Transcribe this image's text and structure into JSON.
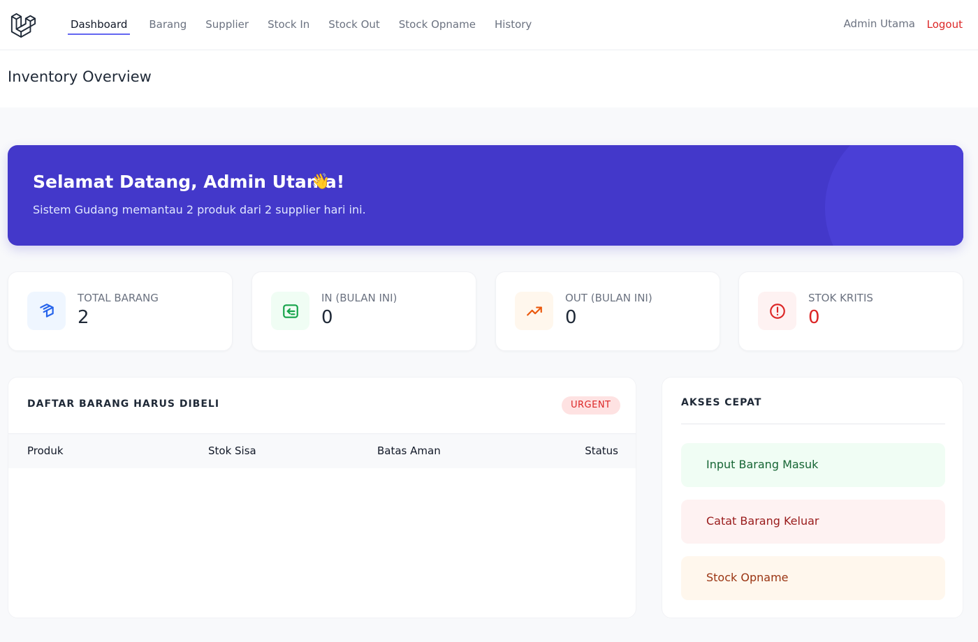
{
  "nav": {
    "items": [
      {
        "label": "Dashboard",
        "active": true
      },
      {
        "label": "Barang",
        "active": false
      },
      {
        "label": "Supplier",
        "active": false
      },
      {
        "label": "Stock In",
        "active": false
      },
      {
        "label": "Stock Out",
        "active": false
      },
      {
        "label": "Stock Opname",
        "active": false
      },
      {
        "label": "History",
        "active": false
      }
    ],
    "user_name": "Admin Utama",
    "logout_label": "Logout",
    "logo_icon": "laravel-logo-icon",
    "accent_color": "#6366f1"
  },
  "header": {
    "title": "Inventory Overview"
  },
  "hero": {
    "title": "Selamat Datang, Admin Utama!",
    "emoji": "👋",
    "subtitle": "Sistem Gudang memantau 2 produk dari 2 supplier hari ini.",
    "bg_color": "#4338ca"
  },
  "stats": [
    {
      "label": "TOTAL BARANG",
      "value": "2",
      "icon": "cube-icon",
      "icon_color": "#2563eb",
      "icon_bg": "#eff6ff",
      "value_color": "#1f2937"
    },
    {
      "label": "IN (BULAN INI)",
      "value": "0",
      "icon": "arrow-in-icon",
      "icon_color": "#16a34a",
      "icon_bg": "#f0fdf4",
      "value_color": "#1f2937"
    },
    {
      "label": "OUT (BULAN INI)",
      "value": "0",
      "icon": "trending-up-icon",
      "icon_color": "#ea580c",
      "icon_bg": "#fff7ed",
      "value_color": "#1f2937"
    },
    {
      "label": "STOK KRITIS",
      "value": "0",
      "icon": "alert-circle-icon",
      "icon_color": "#dc2626",
      "icon_bg": "#fef2f2",
      "value_color": "#dc2626"
    }
  ],
  "restock_table": {
    "title": "DAFTAR BARANG HARUS DIBELI",
    "badge": "URGENT",
    "columns": [
      "Produk",
      "Stok Sisa",
      "Batas Aman",
      "Status"
    ],
    "rows": []
  },
  "quick_access": {
    "title": "AKSES CEPAT",
    "buttons": [
      {
        "label": "Input Barang Masuk",
        "color": "#166534",
        "bg": "#f0fdf4"
      },
      {
        "label": "Catat Barang Keluar",
        "color": "#991b1b",
        "bg": "#fef2f2"
      },
      {
        "label": "Stock Opname",
        "color": "#9a3412",
        "bg": "#fff7ed"
      }
    ]
  }
}
